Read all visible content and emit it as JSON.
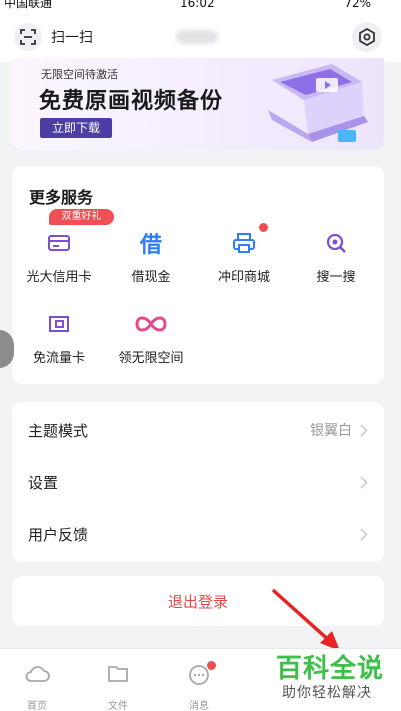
{
  "status_bar": {
    "carrier": "中国联通",
    "time": "16:02",
    "battery": "72%"
  },
  "header": {
    "scan_label": "扫一扫",
    "scan_icon": "scan-icon",
    "settings_icon": "settings-icon"
  },
  "banner": {
    "subtitle": "无限空间待激活",
    "title": "免费原画视频备份",
    "button_label": "立即下载"
  },
  "more_services": {
    "title": "更多服务",
    "badge": "双重好礼",
    "items": [
      {
        "label": "光大信用卡",
        "icon": "credit-card-icon"
      },
      {
        "label": "借现金",
        "icon": "borrow-icon",
        "glyph": "借"
      },
      {
        "label": "冲印商城",
        "icon": "printer-icon"
      },
      {
        "label": "搜一搜",
        "icon": "search-icon"
      },
      {
        "label": "免流量卡",
        "icon": "sim-card-icon"
      },
      {
        "label": "领无限空间",
        "icon": "infinity-icon"
      }
    ]
  },
  "settings": {
    "rows": [
      {
        "label": "主题模式",
        "value": "银翼白"
      },
      {
        "label": "设置",
        "value": ""
      },
      {
        "label": "用户反馈",
        "value": ""
      }
    ]
  },
  "logout": {
    "label": "退出登录"
  },
  "tabbar": {
    "tabs": [
      {
        "label": "首页",
        "icon": "cloud-icon"
      },
      {
        "label": "文件",
        "icon": "folder-icon"
      },
      {
        "label": "消息",
        "icon": "message-icon"
      }
    ]
  },
  "watermark": {
    "title": "百科全说",
    "subtitle": "助你轻松解决"
  },
  "colors": {
    "accent": "#4b3fa6",
    "danger": "#e24a4a",
    "service_blue": "#2f7df6",
    "service_purple": "#7a4fd6",
    "watermark_green": "#3dbf4a"
  }
}
